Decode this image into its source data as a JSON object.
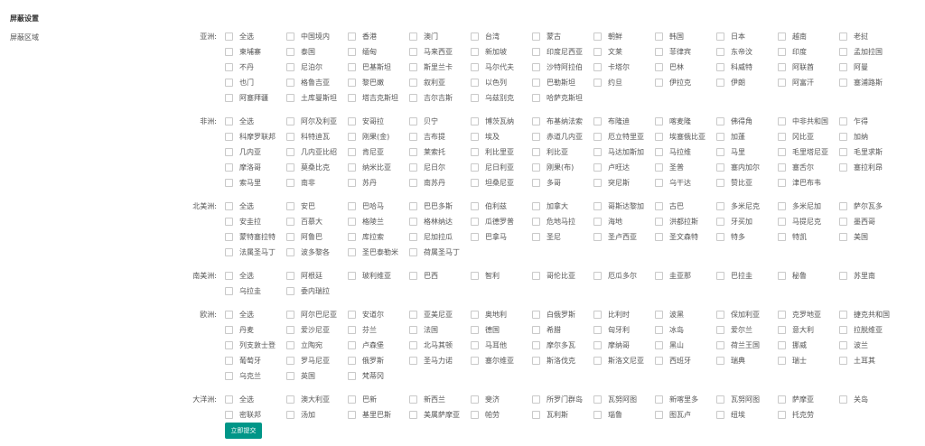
{
  "title": "屏蔽设置",
  "area_label": "屏蔽区域",
  "submit_label": "立即提交",
  "accent_color": "#009688",
  "regions": [
    {
      "name": "亚洲:",
      "items": [
        "全选",
        "中国境内",
        "香港",
        "澳门",
        "台湾",
        "蒙古",
        "朝鲜",
        "韩国",
        "日本",
        "越南",
        "老挝",
        "柬埔寨",
        "泰国",
        "缅甸",
        "马来西亚",
        "新加坡",
        "印度尼西亚",
        "文莱",
        "菲律宾",
        "东帝汶",
        "印度",
        "孟加拉国",
        "不丹",
        "尼泊尔",
        "巴基斯坦",
        "斯里兰卡",
        "马尔代夫",
        "沙特阿拉伯",
        "卡塔尔",
        "巴林",
        "科威特",
        "阿联酋",
        "阿曼",
        "也门",
        "格鲁吉亚",
        "黎巴嫩",
        "叙利亚",
        "以色列",
        "巴勒斯坦",
        "约旦",
        "伊拉克",
        "伊朗",
        "阿富汗",
        "塞浦路斯",
        "阿塞拜疆",
        "土库曼斯坦",
        "塔吉克斯坦",
        "吉尔吉斯",
        "乌兹别克",
        "哈萨克斯坦"
      ]
    },
    {
      "name": "非洲:",
      "items": [
        "全选",
        "阿尔及利亚",
        "安哥拉",
        "贝宁",
        "博茨瓦纳",
        "布基纳法索",
        "布隆迪",
        "喀麦隆",
        "佛得角",
        "中非共和国",
        "乍得",
        "科摩罗联邦",
        "科特迪瓦",
        "刚果(金)",
        "吉布提",
        "埃及",
        "赤道几内亚",
        "厄立特里亚",
        "埃塞俄比亚",
        "加蓬",
        "冈比亚",
        "加纳",
        "几内亚",
        "几内亚比绍",
        "肯尼亚",
        "莱索托",
        "利比里亚",
        "利比亚",
        "马达加斯加",
        "马拉维",
        "马里",
        "毛里塔尼亚",
        "毛里求斯",
        "摩洛哥",
        "莫桑比克",
        "纳米比亚",
        "尼日尔",
        "尼日利亚",
        "刚果(布)",
        "卢旺达",
        "圣普",
        "塞内加尔",
        "塞舌尔",
        "塞拉利昂",
        "索马里",
        "南非",
        "苏丹",
        "南苏丹",
        "坦桑尼亚",
        "多哥",
        "突尼斯",
        "乌干达",
        "赞比亚",
        "津巴布韦"
      ]
    },
    {
      "name": "北美洲:",
      "items": [
        "全选",
        "安巴",
        "巴哈马",
        "巴巴多斯",
        "伯利兹",
        "加拿大",
        "哥斯达黎加",
        "古巴",
        "多米尼克",
        "多米尼加",
        "萨尔瓦多",
        "安圭拉",
        "百慕大",
        "格陵兰",
        "格林纳达",
        "瓜德罗普",
        "危地马拉",
        "海地",
        "洪都拉斯",
        "牙买加",
        "马提尼克",
        "墨西哥",
        "蒙特塞拉特",
        "阿鲁巴",
        "库拉索",
        "尼加拉瓜",
        "巴拿马",
        "圣尼",
        "圣卢西亚",
        "圣文森特",
        "特多",
        "特凯",
        "美国",
        "法属圣马丁",
        "波多黎各",
        "圣巴泰勒米",
        "荷属圣马丁"
      ]
    },
    {
      "name": "南美洲:",
      "items": [
        "全选",
        "阿根廷",
        "玻利维亚",
        "巴西",
        "智利",
        "哥伦比亚",
        "厄瓜多尔",
        "圭亚那",
        "巴拉圭",
        "秘鲁",
        "苏里南",
        "乌拉圭",
        "委内瑞拉"
      ]
    },
    {
      "name": "欧洲:",
      "items": [
        "全选",
        "阿尔巴尼亚",
        "安道尔",
        "亚美尼亚",
        "奥地利",
        "白俄罗斯",
        "比利时",
        "波黑",
        "保加利亚",
        "克罗地亚",
        "捷克共和国",
        "丹麦",
        "爱沙尼亚",
        "芬兰",
        "法国",
        "德国",
        "希腊",
        "匈牙利",
        "冰岛",
        "爱尔兰",
        "意大利",
        "拉脱维亚",
        "列支敦士登",
        "立陶宛",
        "卢森堡",
        "北马其顿",
        "马耳他",
        "摩尔多瓦",
        "摩纳哥",
        "黑山",
        "荷兰王国",
        "挪威",
        "波兰",
        "葡萄牙",
        "罗马尼亚",
        "俄罗斯",
        "圣马力诺",
        "塞尔维亚",
        "斯洛伐克",
        "斯洛文尼亚",
        "西班牙",
        "瑞典",
        "瑞士",
        "土耳其",
        "乌克兰",
        "英国",
        "梵蒂冈"
      ]
    },
    {
      "name": "大洋洲:",
      "items": [
        "全选",
        "澳大利亚",
        "巴新",
        "新西兰",
        "斐济",
        "所罗门群岛",
        "瓦努阿图",
        "新喀里多",
        "瓦努阿图",
        "萨摩亚",
        "关岛",
        "密联邦",
        "汤加",
        "基里巴斯",
        "美属萨摩亚",
        "帕劳",
        "瓦利斯",
        "瑙鲁",
        "图瓦卢",
        "纽埃",
        "托克劳"
      ]
    }
  ]
}
